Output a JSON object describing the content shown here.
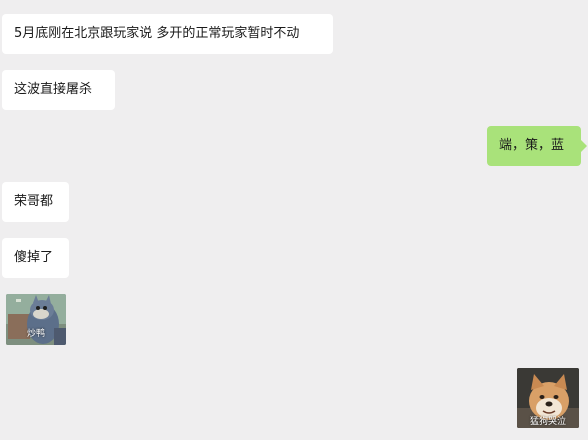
{
  "messages": [
    {
      "side": "left",
      "text": "5月底刚在北京跟玩家说 多开的正常玩家暂时不动"
    },
    {
      "side": "left",
      "text": "这波直接屠杀"
    },
    {
      "side": "right",
      "text": "端，策，蓝"
    },
    {
      "side": "left",
      "text": "荣哥都"
    },
    {
      "side": "left",
      "text": "傻掉了"
    }
  ],
  "stickers": {
    "cat": {
      "caption": "炒鸭",
      "icon": "tom-cat-sticker"
    },
    "dog": {
      "caption": "猛狗哭泣",
      "icon": "crying-shiba-dog-sticker"
    }
  },
  "colors": {
    "background": "#efeeef",
    "incoming_bubble": "#ffffff",
    "outgoing_bubble": "#a9e27a"
  }
}
